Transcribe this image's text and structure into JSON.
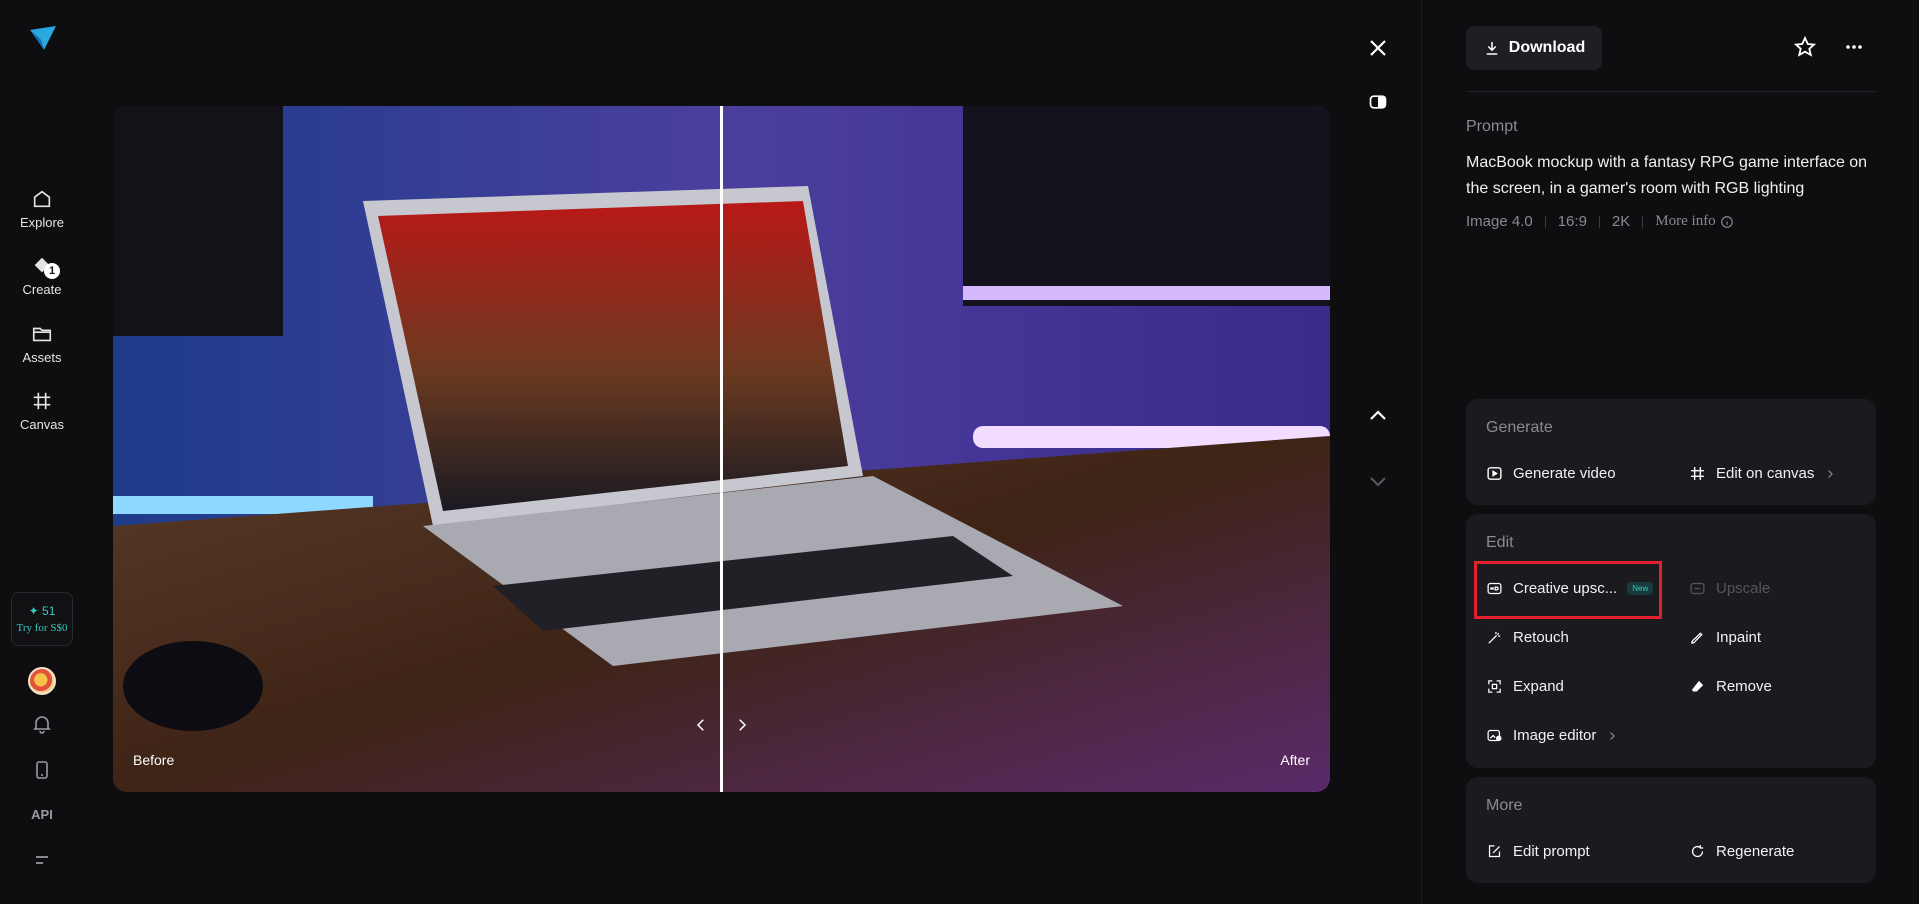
{
  "sidebar": {
    "items": [
      {
        "label": "Explore",
        "icon": "home-icon"
      },
      {
        "label": "Create",
        "icon": "create-icon",
        "badge": "1"
      },
      {
        "label": "Assets",
        "icon": "folder-icon"
      },
      {
        "label": "Canvas",
        "icon": "canvas-icon"
      }
    ],
    "credits": {
      "count": "✦ 51",
      "cta": "Try for S$0"
    },
    "api_label": "API"
  },
  "viewer": {
    "before_label": "Before",
    "after_label": "After"
  },
  "toolbar": {
    "download_label": "Download"
  },
  "prompt": {
    "label": "Prompt",
    "text": "MacBook mockup with a fantasy RPG game interface on the screen, in a gamer's room with RGB lighting",
    "model": "Image 4.0",
    "ratio": "16:9",
    "resolution": "2K",
    "more_info": "More info"
  },
  "generate": {
    "title": "Generate",
    "generate_video": "Generate video",
    "edit_on_canvas": "Edit on canvas"
  },
  "edit": {
    "title": "Edit",
    "creative_upscale": "Creative upsc...",
    "new_tag": "New",
    "upscale": "Upscale",
    "retouch": "Retouch",
    "inpaint": "Inpaint",
    "expand": "Expand",
    "remove": "Remove",
    "image_editor": "Image editor"
  },
  "more": {
    "title": "More",
    "edit_prompt": "Edit prompt",
    "regenerate": "Regenerate"
  },
  "colors": {
    "accent": "#35c6c0",
    "highlight": "#e0202c",
    "background": "#0e0e10",
    "card": "#1b1b1f"
  }
}
